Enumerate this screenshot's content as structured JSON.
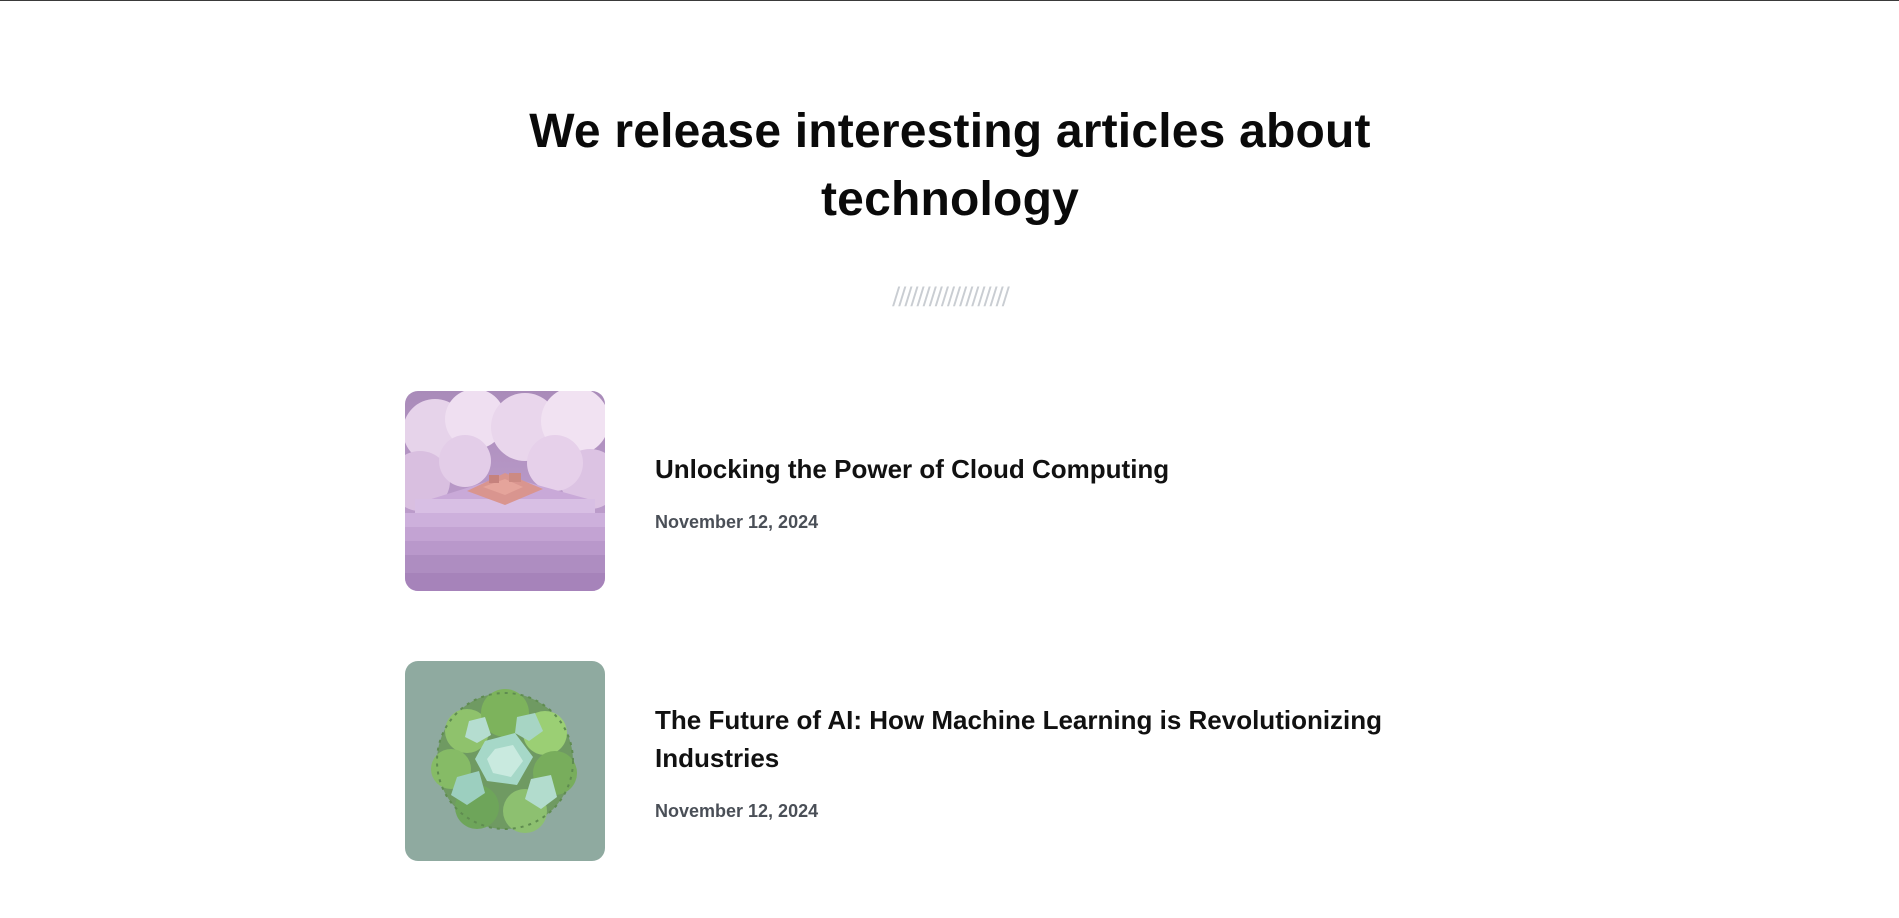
{
  "hero": {
    "title": "We release interesting articles about technology",
    "divider": "///////////////////"
  },
  "articles": [
    {
      "title": "Unlocking the Power of Cloud Computing",
      "date": "November 12, 2024",
      "thumbnail_icon": "cloud-platform-illustration"
    },
    {
      "title": "The Future of AI: How Machine Learning is Revolutionizing Industries",
      "date": "November 12, 2024",
      "thumbnail_icon": "green-crystal-illustration"
    }
  ],
  "colors": {
    "text": "#0a0a0a",
    "date": "#4a4f57",
    "divider": "#c9cdd2",
    "thumb_1_bg": "#b89ac8",
    "thumb_2_bg": "#8faaa0"
  }
}
